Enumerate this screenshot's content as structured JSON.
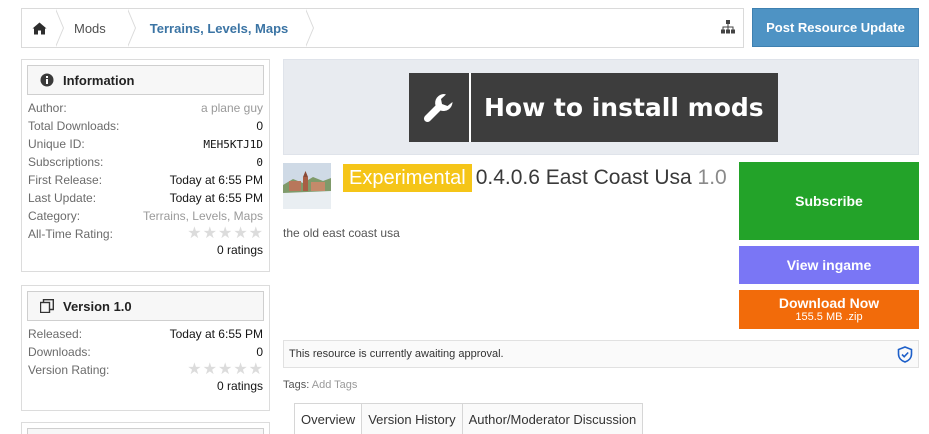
{
  "breadcrumb": {
    "items": [
      "Mods",
      "Terrains, Levels, Maps"
    ]
  },
  "actions": {
    "post_update_label": "Post Resource Update"
  },
  "information": {
    "heading": "Information",
    "rows": [
      {
        "key": "Author:",
        "value": "a plane guy"
      },
      {
        "key": "Total Downloads:",
        "value": "0"
      },
      {
        "key": "Unique ID:",
        "value": "MEH5KTJ1D"
      },
      {
        "key": "Subscriptions:",
        "value": "0"
      },
      {
        "key": "First Release:",
        "value": "Today at 6:55 PM"
      },
      {
        "key": "Last Update:",
        "value": "Today at 6:55 PM"
      },
      {
        "key": "Category:",
        "value": "Terrains, Levels, Maps"
      },
      {
        "key": "All-Time Rating:",
        "value": ""
      }
    ],
    "rating_stars": 0,
    "ratings_count": "0 ratings"
  },
  "version_box": {
    "heading": "Version 1.0",
    "rows": [
      {
        "key": "Released:",
        "value": "Today at 6:55 PM"
      },
      {
        "key": "Downloads:",
        "value": "0"
      },
      {
        "key": "Version Rating:",
        "value": ""
      }
    ],
    "rating_stars": 0,
    "ratings_count": "0 ratings"
  },
  "banner": {
    "text": "How to install mods"
  },
  "resource": {
    "badge": "Experimental",
    "title": "0.4.0.6 East Coast Usa",
    "version": "1.0",
    "tagline": "the old east coast usa"
  },
  "buttons": {
    "subscribe": "Subscribe",
    "view_ingame": "View ingame",
    "download": "Download Now",
    "download_size": "155.5 MB .zip"
  },
  "notice": {
    "text": "This resource is currently awaiting approval."
  },
  "tags": {
    "label": "Tags:",
    "add": "Add Tags"
  },
  "tabs": [
    "Overview",
    "Version History",
    "Author/Moderator Discussion"
  ],
  "colors": {
    "subscribe": "#23a329",
    "view_ingame": "#7a76f5",
    "download": "#f26b0a",
    "badge": "#f5c518",
    "post_button": "#4e93c4"
  }
}
